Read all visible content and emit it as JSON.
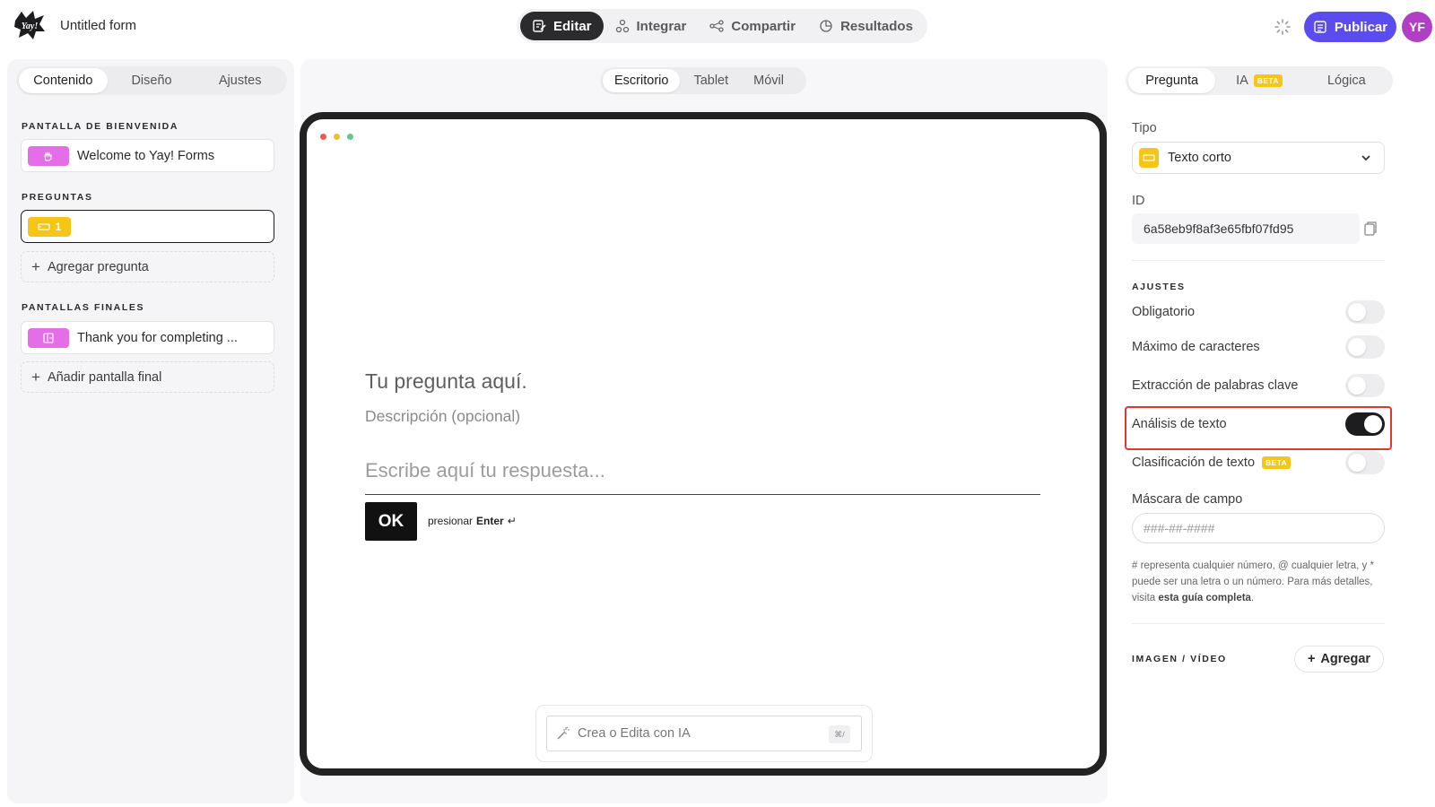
{
  "header": {
    "form_title": "Untitled form",
    "modes": [
      {
        "label": "Editar",
        "icon": "edit-icon",
        "active": true
      },
      {
        "label": "Integrar",
        "icon": "integrate-icon",
        "active": false
      },
      {
        "label": "Compartir",
        "icon": "share-icon",
        "active": false
      },
      {
        "label": "Resultados",
        "icon": "results-icon",
        "active": false
      }
    ],
    "publish_label": "Publicar",
    "avatar_initials": "YF",
    "brand_color": "#5b4cf0",
    "avatar_color": "#b13fc4"
  },
  "left": {
    "tabs": [
      {
        "label": "Contenido",
        "active": true
      },
      {
        "label": "Diseño",
        "active": false
      },
      {
        "label": "Ajustes",
        "active": false
      }
    ],
    "welcome_section": "PANTALLA DE BIENVENIDA",
    "welcome_item": "Welcome to Yay! Forms",
    "questions_section": "PREGUNTAS",
    "question_number": "1",
    "add_question": "Agregar pregunta",
    "endings_section": "PANTALLAS FINALES",
    "ending_item": "Thank you for completing ...",
    "add_ending": "Añadir pantalla final"
  },
  "center": {
    "devices": [
      {
        "label": "Escritorio",
        "active": true
      },
      {
        "label": "Tablet",
        "active": false
      },
      {
        "label": "Móvil",
        "active": false
      }
    ],
    "question_title": "Tu pregunta aquí.",
    "question_description": "Descripción (opcional)",
    "answer_placeholder": "Escribe aquí tu respuesta...",
    "ok_label": "OK",
    "press_label": "presionar",
    "enter_label": "Enter",
    "ai_placeholder": "Crea o Edita con IA",
    "ai_shortcut": "⌘/"
  },
  "right": {
    "tabs": [
      {
        "label": "Pregunta",
        "active": true
      },
      {
        "label": "IA",
        "active": false,
        "badge": "BETA"
      },
      {
        "label": "Lógica",
        "active": false
      }
    ],
    "type_label": "Tipo",
    "type_value": "Texto corto",
    "id_label": "ID",
    "id_value": "6a58eb9f8af3e65fbf07fd95",
    "settings_section": "AJUSTES",
    "toggles": [
      {
        "label": "Obligatorio",
        "on": false
      },
      {
        "label": "Máximo de caracteres",
        "on": false
      },
      {
        "label": "Extracción de palabras clave",
        "on": false
      },
      {
        "label": "Análisis de texto",
        "on": true
      },
      {
        "label": "Clasificación de texto",
        "on": false,
        "badge": "BETA"
      }
    ],
    "mask_label": "Máscara de campo",
    "mask_placeholder": "###-##-####",
    "help_text_1": "# representa cualquier número, @ cualquier letra, y * puede ser una letra o un número. Para más detalles, visita",
    "help_link": "esta guía completa",
    "help_end": ".",
    "media_section": "IMAGEN / VÍDEO",
    "add_label": "Agregar"
  }
}
